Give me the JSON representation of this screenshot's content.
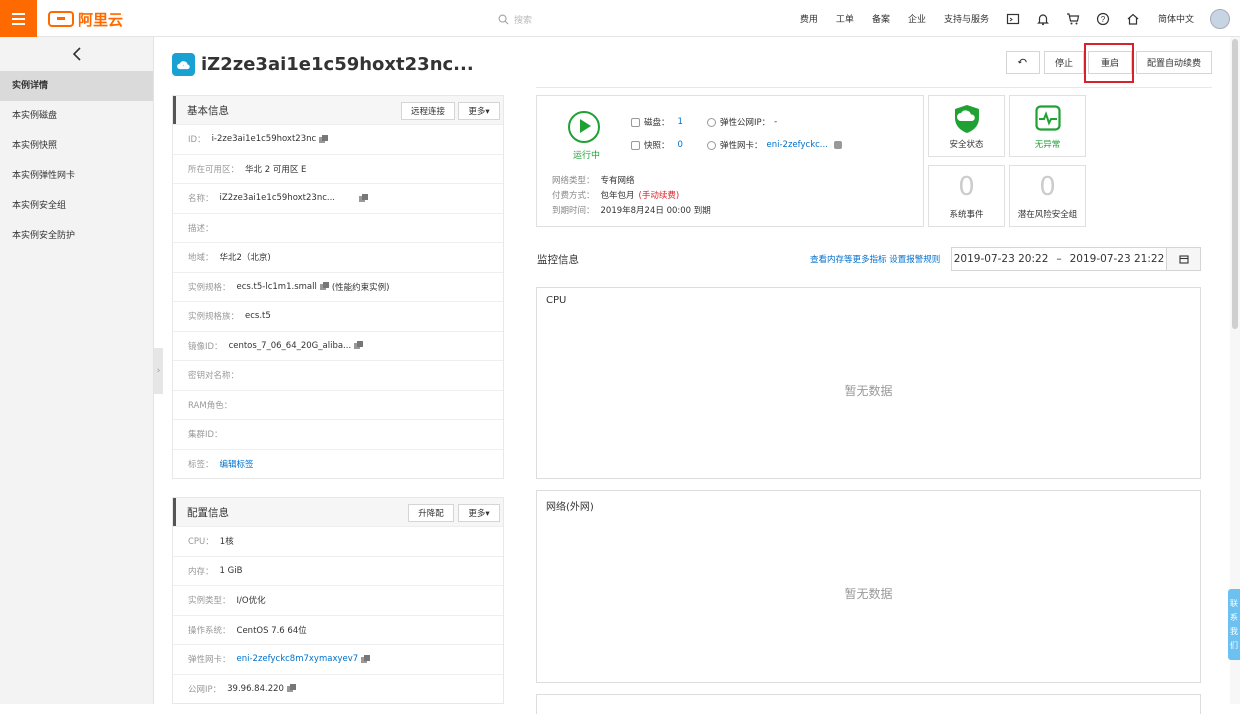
{
  "topbar": {
    "brand": "阿里云",
    "search_placeholder": "搜索",
    "nav": [
      "费用",
      "工单",
      "备案",
      "企业",
      "支持与服务"
    ],
    "lang": "简体中文"
  },
  "sidebar": {
    "items": [
      "实例详情",
      "本实例磁盘",
      "本实例快照",
      "本实例弹性网卡",
      "本实例安全组",
      "本实例安全防护"
    ]
  },
  "instance": {
    "title": "iZ2ze3ai1e1c59hoxt23nc...",
    "actions": {
      "stop": "停止",
      "restart": "重启",
      "renew": "配置自动续费"
    }
  },
  "basic": {
    "title": "基本信息",
    "remote": "远程连接",
    "more": "更多▾",
    "rows": [
      {
        "k": "ID：",
        "v": "i-2ze3ai1e1c59hoxt23nc",
        "copy": true
      },
      {
        "k": "所在可用区：",
        "v": "华北 2 可用区 E"
      },
      {
        "k": "名称：",
        "v": "iZ2ze3ai1e1c59hoxt23nc...",
        "copy": true
      },
      {
        "k": "描述：",
        "v": ""
      },
      {
        "k": "地域：",
        "v": "华北2（北京)"
      },
      {
        "k": "实例规格：",
        "v": "ecs.t5-lc1m1.small",
        "copy": true,
        "extra": "(性能约束实例)"
      },
      {
        "k": "实例规格族：",
        "v": "ecs.t5"
      },
      {
        "k": "镜像ID：",
        "v": "centos_7_06_64_20G_aliba...",
        "copy": true
      },
      {
        "k": "密钥对名称：",
        "v": ""
      },
      {
        "k": "RAM角色：",
        "v": ""
      },
      {
        "k": "集群ID：",
        "v": ""
      },
      {
        "k": "标签：",
        "v": "编辑标签",
        "link": true
      }
    ]
  },
  "config": {
    "title": "配置信息",
    "upgrade": "升降配",
    "more": "更多▾",
    "rows": [
      {
        "k": "CPU：",
        "v": "1核"
      },
      {
        "k": "内存：",
        "v": "1 GiB"
      },
      {
        "k": "实例类型：",
        "v": "I/O优化"
      },
      {
        "k": "操作系统：",
        "v": "CentOS 7.6 64位"
      },
      {
        "k": "弹性网卡：",
        "v": "eni-2zefyckc8m7xymaxyev7",
        "copy": true,
        "link": true
      },
      {
        "k": "公网IP：",
        "v": "39.96.84.220",
        "copy": true
      }
    ]
  },
  "status": {
    "running": "运行中",
    "disk_label": "磁盘：",
    "disk_val": "1",
    "snap_label": "快照：",
    "snap_val": "0",
    "eip_label": "弹性公网IP：",
    "eip_val": "-",
    "eni_label": "弹性网卡：",
    "eni_val": "eni-2zefyckc...",
    "net_label": "网络类型：",
    "net_val": "专有网络",
    "pay_label": "付费方式：",
    "pay_val": "包年包月",
    "pay_note": "(手动续费)",
    "exp_label": "到期时间：",
    "exp_val": "2019年8月24日 00:00 到期"
  },
  "cards": {
    "security": "安全状态",
    "normal": "无异常",
    "events_num": "0",
    "events": "系统事件",
    "risk_num": "0",
    "risk": "潜在风险安全组"
  },
  "monitor": {
    "title": "监控信息",
    "links": "查看内存等更多指标 设置报警规则",
    "start": "2019-07-23 20:22",
    "sep": "–",
    "end": "2019-07-23 21:22"
  },
  "charts": [
    {
      "title": "CPU",
      "nodata": "暂无数据"
    },
    {
      "title": "网络(外网)",
      "nodata": "暂无数据"
    }
  ],
  "contact": [
    "联",
    "系",
    "我",
    "们"
  ],
  "colors": {
    "brand": "#ff6a00",
    "link": "#0070cc",
    "running": "#1fa134",
    "highlight": "#d6232b"
  }
}
